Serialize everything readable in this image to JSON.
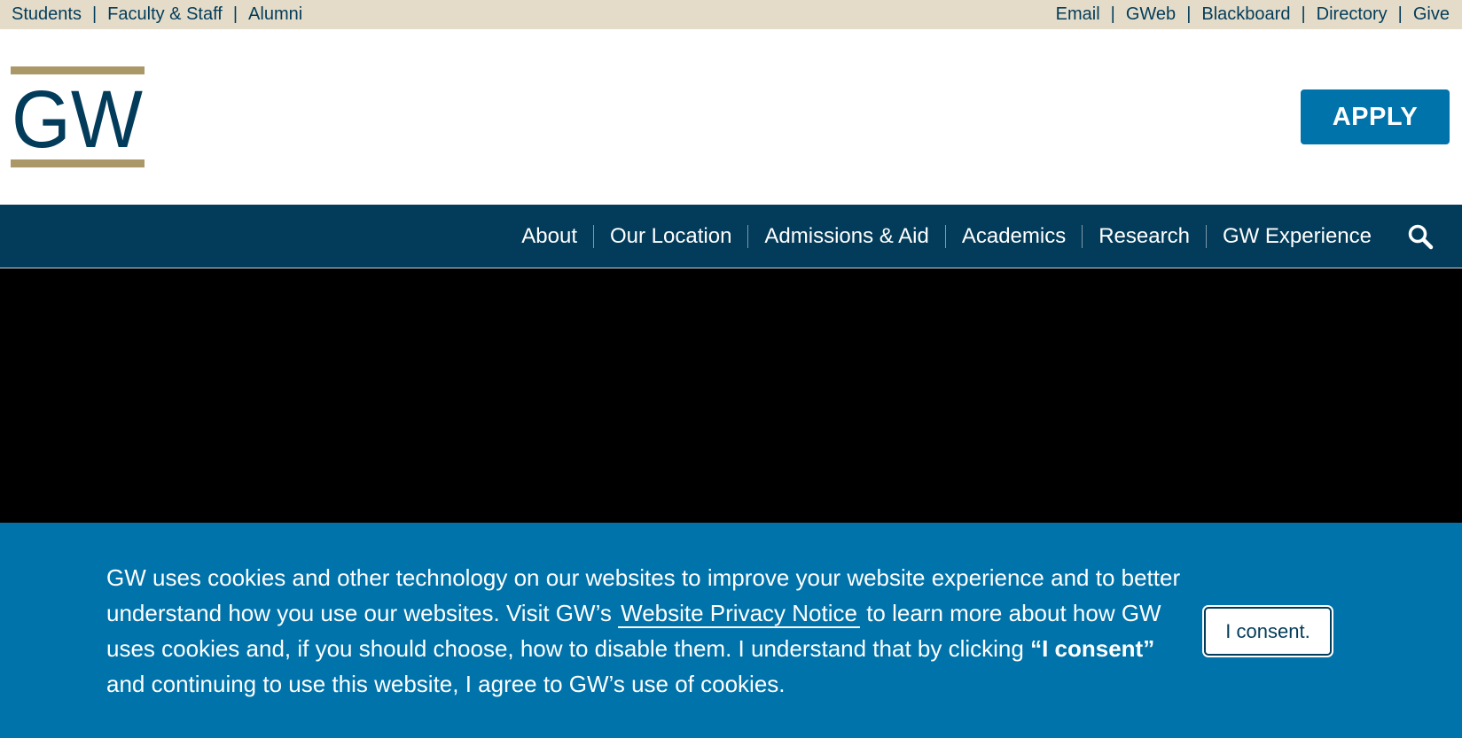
{
  "utility": {
    "left_links": [
      "Students",
      "Faculty & Staff",
      "Alumni"
    ],
    "right_links": [
      "Email",
      "GWeb",
      "Blackboard",
      "Directory",
      "Give"
    ],
    "separator": "|"
  },
  "header": {
    "logo_text": "GW",
    "apply_label": "APPLY"
  },
  "nav": {
    "items": [
      "About",
      "Our Location",
      "Admissions & Aid",
      "Academics",
      "Research",
      "GW Experience"
    ],
    "search_icon": "search-icon"
  },
  "cookie": {
    "text_before_link": "GW uses cookies and other technology on our websites to improve your website experience and to better understand how you use our websites. Visit GW’s",
    "link_text": "Website Privacy Notice",
    "text_after_link": "to learn more about how GW uses cookies and, if you should choose, how to disable them. I understand that by clicking",
    "strong_text": "“I consent”",
    "text_end": "and continuing to use this website, I agree to GW’s use of cookies.",
    "consent_label": "I consent."
  },
  "colors": {
    "utility_bg": "#e4dcc9",
    "navy": "#033c5a",
    "blue": "#0073aa",
    "gold": "#aa9868"
  }
}
